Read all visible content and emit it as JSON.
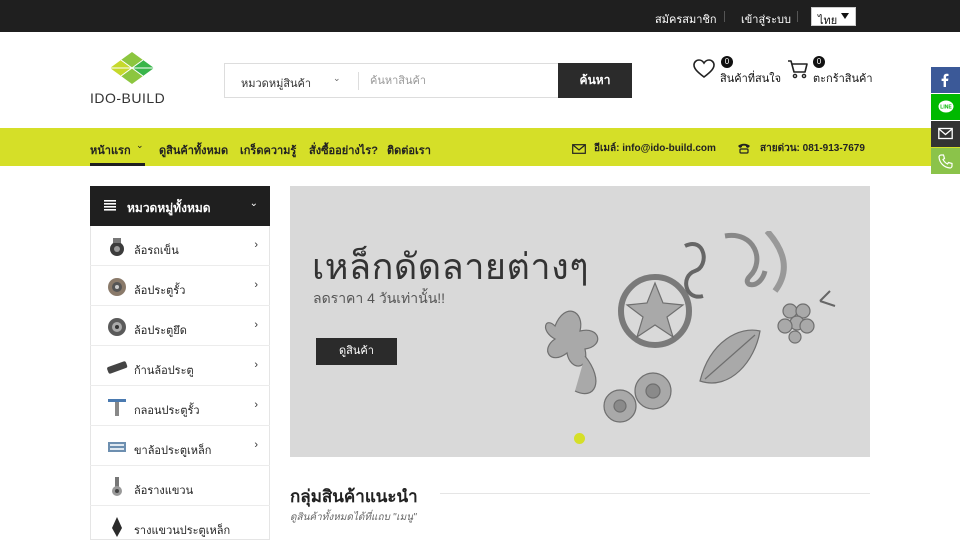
{
  "topbar": {
    "register": "สมัครสมาชิก",
    "login": "เข้าสู่ระบบ",
    "language": "ไทย"
  },
  "header": {
    "logo_text": "IDO-BUILD",
    "search": {
      "category_label": "หมวดหมู่สินค้า",
      "placeholder": "ค้นหาสินค้า",
      "button": "ค้นหา"
    },
    "wishlist": {
      "count": "0",
      "label": "สินค้าที่สนใจ"
    },
    "cart": {
      "count": "0",
      "label": "ตะกร้าสินค้า"
    }
  },
  "nav": {
    "items": [
      {
        "label": "หน้าแรก"
      },
      {
        "label": "ดูสินค้าทั้งหมด"
      },
      {
        "label": "เกร็ดความรู้"
      },
      {
        "label": "สั่งซื้ออย่างไร?"
      },
      {
        "label": "ติดต่อเรา"
      }
    ],
    "email": "อีเมล์: info@ido-build.com",
    "hotline": "สายด่วน: 081-913-7679"
  },
  "categories": {
    "title": "หมวดหมู่ทั้งหมด",
    "items": [
      {
        "label": "ล้อรถเข็น"
      },
      {
        "label": "ล้อประตูรั้ว"
      },
      {
        "label": "ล้อประตูยึด"
      },
      {
        "label": "ก้านล้อประตู"
      },
      {
        "label": "กลอนประตูรั้ว"
      },
      {
        "label": "ขาล้อประตูเหล็ก"
      },
      {
        "label": "ล้อรางแขวน"
      },
      {
        "label": "รางแขวนประตูเหล็ก"
      }
    ]
  },
  "banner": {
    "title": "เหล็กดัดลายต่างๆ",
    "subtitle": "ลดราคา 4 วันเท่านั้น!!",
    "button": "ดูสินค้า"
  },
  "section": {
    "title": "กลุ่มสินค้าแนะนำ",
    "subtitle": "ดูสินค้าทั้งหมดได้ที่แถบ \"เมนู\""
  },
  "colors": {
    "accent": "#d5df28",
    "dark": "#1f1f1f",
    "facebook": "#3b5998",
    "line": "#00b900",
    "email": "#333333",
    "phone": "#8bc34a"
  },
  "social": [
    "facebook-icon",
    "line-icon",
    "email-icon",
    "phone-icon"
  ]
}
